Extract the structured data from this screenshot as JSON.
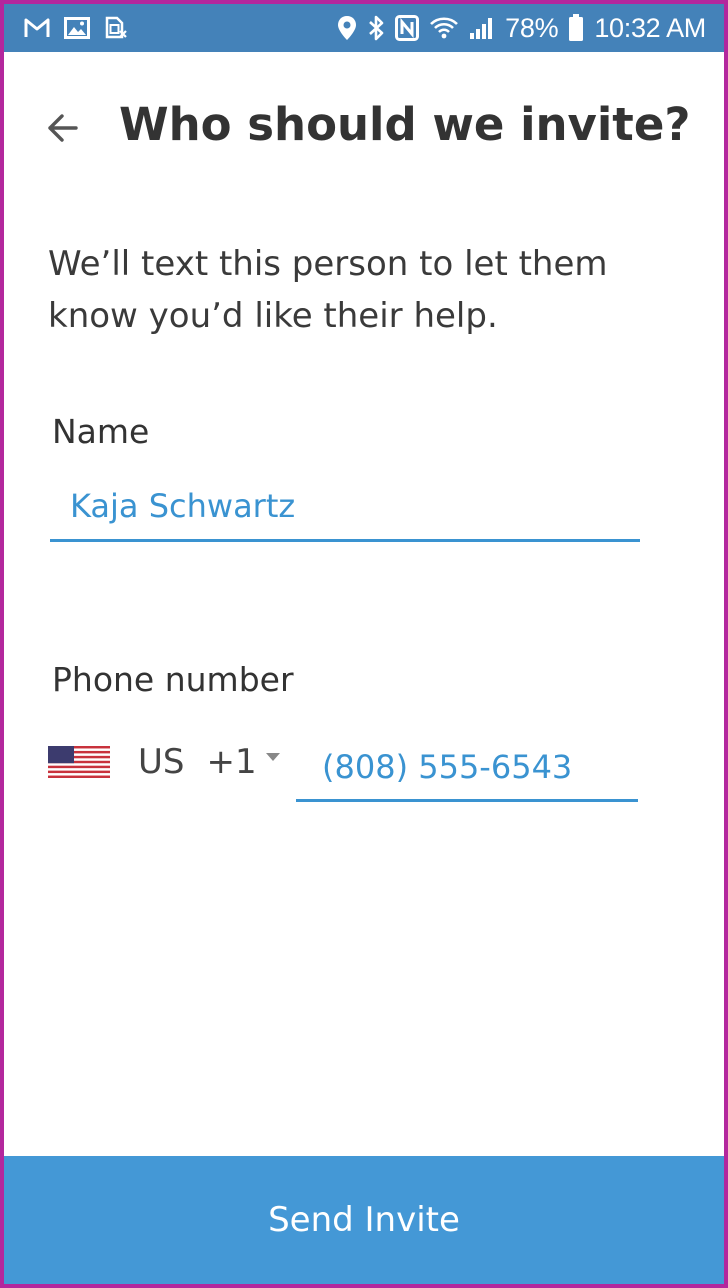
{
  "status_bar": {
    "left_icons": [
      "gmail-icon",
      "gallery-icon",
      "sim-icon"
    ],
    "right_icons": [
      "location-icon",
      "bluetooth-icon",
      "nfc-icon",
      "wifi-icon",
      "signal-icon",
      "battery-icon"
    ],
    "battery_percent": "78%",
    "time": "10:32 AM"
  },
  "header": {
    "title": "Who should we invite?"
  },
  "description": "We’ll text this person to let them know you’d like their help.",
  "form": {
    "name_label": "Name",
    "name_value": "Kaja Schwartz",
    "phone_label": "Phone number",
    "country_code": "US",
    "dial_code": "+1",
    "phone_value": "(808) 555-6543"
  },
  "send_button_label": "Send Invite",
  "colors": {
    "status_bar": "#4482b9",
    "accent": "#3a93d1",
    "button": "#4498d6",
    "frame_border": "#b3279d"
  }
}
